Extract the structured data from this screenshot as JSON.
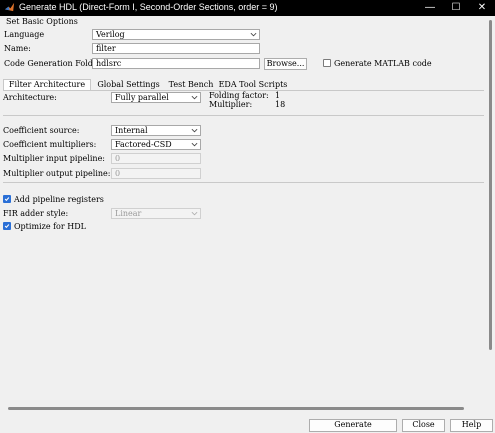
{
  "window": {
    "title": "Generate HDL (Direct-Form I, Second-Order Sections, order = 9)",
    "minimize": "—",
    "maximize": "☐",
    "close": "✕"
  },
  "basic": {
    "group_title": "Set Basic Options",
    "language_label": "Language",
    "language_value": "Verilog",
    "name_label": "Name:",
    "name_value": "filter",
    "folder_label": "Code Generation Folder",
    "folder_value": "hdlsrc",
    "browse_label": "Browse...",
    "generate_matlab_label": "Generate MATLAB code",
    "generate_matlab_checked": false
  },
  "tabs": [
    {
      "label": "Filter Architecture",
      "active": true
    },
    {
      "label": "Global Settings",
      "active": false
    },
    {
      "label": "Test Bench",
      "active": false
    },
    {
      "label": "EDA Tool Scripts",
      "active": false
    }
  ],
  "arch": {
    "architecture_label": "Architecture:",
    "architecture_value": "Fully parallel",
    "folding_label": "Folding factor:",
    "folding_value": "1",
    "multiplier_label": "Multiplier:",
    "multiplier_value": "18",
    "coeff_source_label": "Coefficient source:",
    "coeff_source_value": "Internal",
    "coeff_mult_label": "Coefficient multipliers:",
    "coeff_mult_value": "Factored-CSD",
    "mult_in_label": "Multiplier input pipeline:",
    "mult_in_value": "0",
    "mult_out_label": "Multiplier output pipeline:",
    "mult_out_value": "0",
    "add_pipeline_label": "Add pipeline registers",
    "add_pipeline_checked": true,
    "fir_adder_label": "FIR adder style:",
    "fir_adder_value": "Linear",
    "optimize_label": "Optimize for HDL",
    "optimize_checked": true
  },
  "footer": {
    "generate_label": "Generate",
    "close_label": "Close",
    "help_label": "Help"
  }
}
